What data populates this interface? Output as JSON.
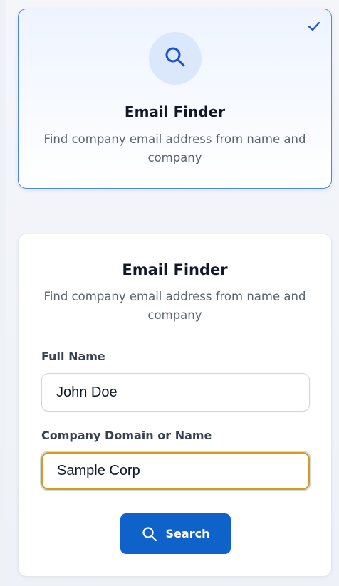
{
  "selected_tool": {
    "title": "Email Finder",
    "description": "Find company email address from name and company",
    "icon": "search-icon",
    "selected_icon": "check-icon",
    "accent_color": "#1d4ed8"
  },
  "form": {
    "title": "Email Finder",
    "description": "Find company email address from name and company",
    "full_name_label": "Full Name",
    "full_name_value": "John Doe",
    "company_label": "Company Domain or Name",
    "company_value": "Sample Corp",
    "search_label": "Search",
    "button_color": "#0f62c9"
  }
}
